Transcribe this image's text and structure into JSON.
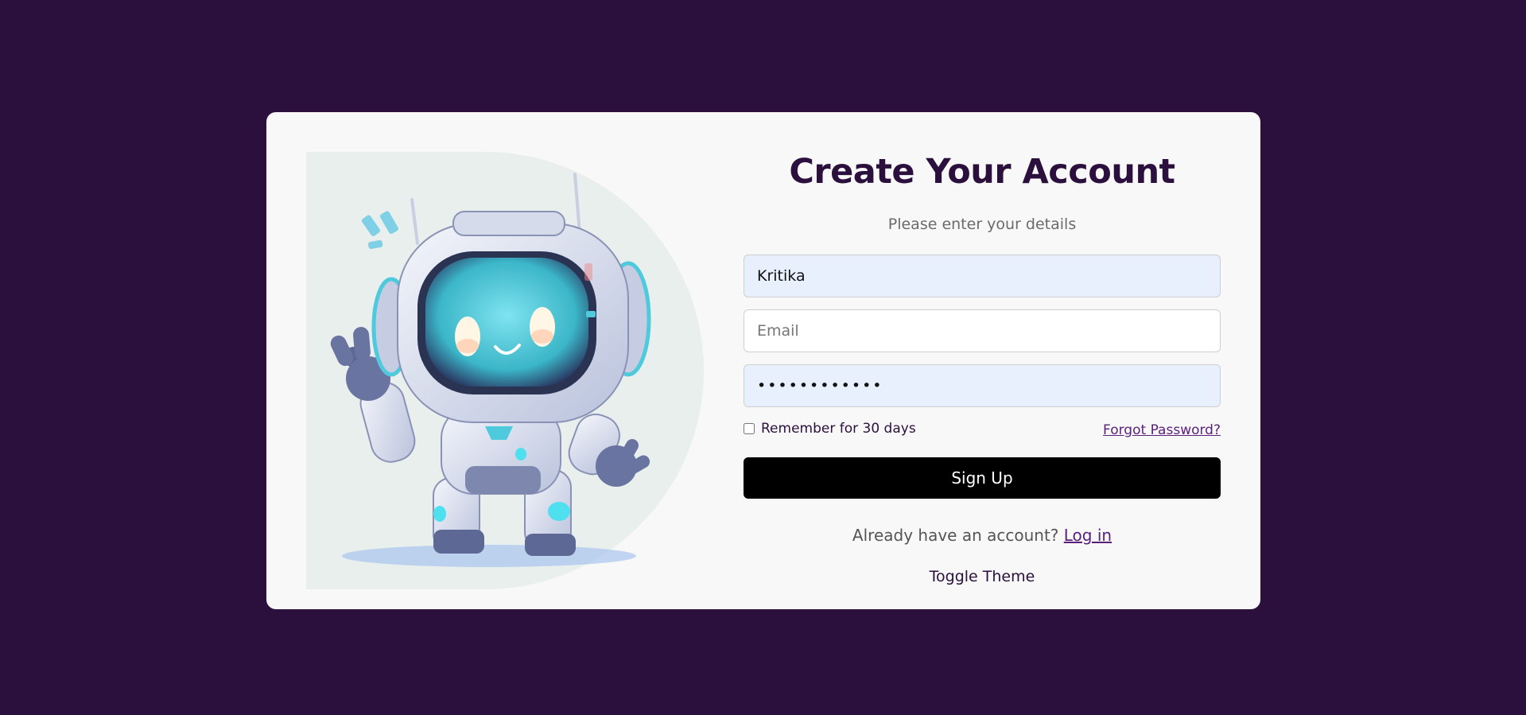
{
  "form": {
    "title": "Create Your Account",
    "subtitle": "Please enter your details",
    "name_value": "Kritika",
    "email_placeholder": "Email",
    "password_value": "••••••••••••",
    "remember_label": "Remember for 30 days",
    "forgot_label": "Forgot Password?",
    "signup_label": "Sign Up",
    "login_prompt": "Already have an account?",
    "login_label": "Log in",
    "toggle_label": "Toggle Theme"
  },
  "colors": {
    "page_background": "#2b0f3d",
    "card_background": "#f8f8f8",
    "accent": "#5a1f7a",
    "button": "#000000",
    "autofill": "#e8f0fe"
  },
  "illustration": {
    "icon": "robot-mascot-icon"
  }
}
